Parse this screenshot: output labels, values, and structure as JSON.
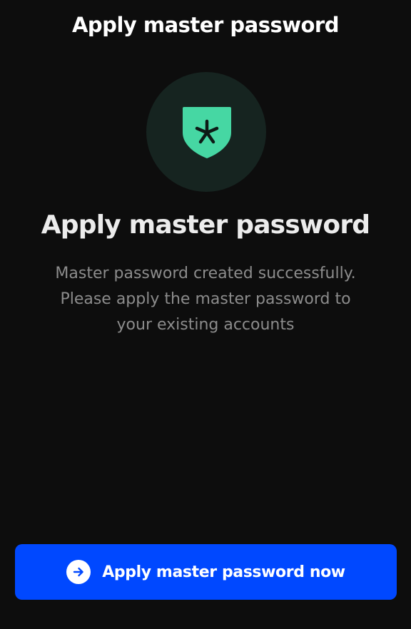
{
  "header": {
    "title": "Apply master password"
  },
  "badge": {
    "icon": "shield-asterisk-icon",
    "circle_color": "#162420",
    "shield_color": "#46d7a3"
  },
  "main": {
    "title": "Apply master password",
    "description_lines": [
      "Master password created successfully.",
      "Please apply the master password to",
      "your existing accounts"
    ]
  },
  "action": {
    "label": "Apply master password now",
    "icon": "arrow-right-circle-icon",
    "color": "#0048ff"
  }
}
